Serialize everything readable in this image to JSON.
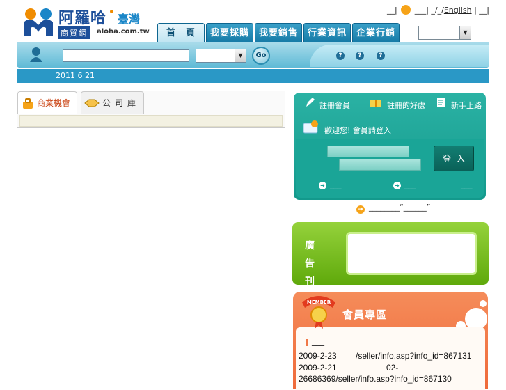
{
  "logo": {
    "name_cn": "阿羅哈",
    "region": "臺灣",
    "subtitle": "商貿網",
    "domain": "aloha.com.tw"
  },
  "top_links": {
    "sep1": "__|",
    "sep2": "___|",
    "sep3": "_/_/",
    "english": "English",
    "sep4": "|",
    "sep5": "__|"
  },
  "nav": {
    "tabs": [
      {
        "label": "首　頁",
        "active": true
      },
      {
        "label": "我要採購",
        "active": false
      },
      {
        "label": "我要銷售",
        "active": false
      },
      {
        "label": "行業資訊",
        "active": false
      },
      {
        "label": "企業行銷",
        "active": false
      }
    ],
    "language_select": ""
  },
  "search": {
    "placeholder": "",
    "category_value": "",
    "go_label": "Go",
    "help_icons": [
      "?",
      "?",
      "?"
    ]
  },
  "date_bar": {
    "date": "2011  6 21"
  },
  "left_tabs": [
    {
      "label": "商業機會",
      "active": true
    },
    {
      "label": "公司庫",
      "active": false
    }
  ],
  "login_panel": {
    "links": [
      "註冊會員",
      "註冊的好處",
      "新手上路"
    ],
    "welcome": "歡迎您! 會員請登入",
    "username_value": "",
    "password_value": "",
    "login_button": "登入",
    "forgot_links": [
      "___",
      "___",
      "___"
    ]
  },
  "promo": {
    "text": "________“______”"
  },
  "ad": {
    "label": "廣告刊登"
  },
  "member_area": {
    "title": "會員專區",
    "badge": "MEMBER",
    "header_line": "___",
    "rows": [
      {
        "date": "2009-2-23",
        "text": "/seller/info.asp?info_id=867131"
      },
      {
        "date": "2009-2-21",
        "text": "02-"
      },
      {
        "date": "",
        "text": "26686369/seller/info.asp?info_id=867130"
      }
    ]
  },
  "colors": {
    "nav_blue": "#157aa6",
    "date_bar": "#2a98c6",
    "login_teal": "#1aa597",
    "ad_green": "#6db21a",
    "member_orange": "#f07848",
    "tab_active_text": "#c9400f"
  }
}
